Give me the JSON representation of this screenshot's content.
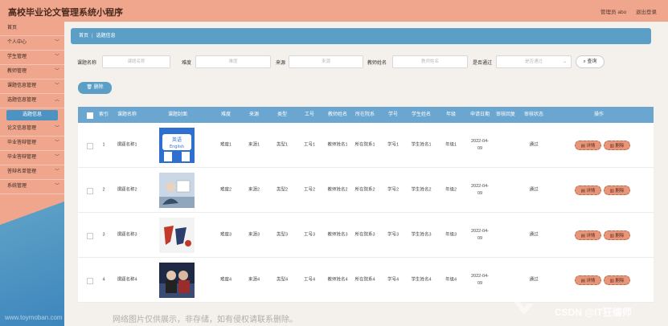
{
  "header": {
    "title": "高校毕业论文管理系统小程序",
    "admin": "管理员 abo",
    "logout": "退出登录"
  },
  "sidebar": {
    "items": [
      {
        "label": "首页",
        "chev": false
      },
      {
        "label": "个人中心",
        "chev": true
      },
      {
        "label": "学生管理",
        "chev": true
      },
      {
        "label": "教师管理",
        "chev": true
      },
      {
        "label": "课题信息管理",
        "chev": true
      },
      {
        "label": "选题信息管理",
        "chev": true
      }
    ],
    "active_sub": "选题信息",
    "items2": [
      {
        "label": "论文信息管理"
      },
      {
        "label": "毕业答辩管理"
      },
      {
        "label": "毕业答辩管理"
      },
      {
        "label": "答辩名单管理"
      },
      {
        "label": "系统管理"
      }
    ]
  },
  "breadcrumb": {
    "home": "首页",
    "sep": "|",
    "current": "选题信息"
  },
  "search": {
    "f1_label": "课题名称",
    "f1_ph": "课题名称",
    "f2_label": "难度",
    "f2_ph": "难度",
    "f3_label": "来源",
    "f3_ph": "来源",
    "f4_label": "教师姓名",
    "f4_ph": "教师姓名",
    "f5_label": "是否通过",
    "f5_ph": "是否通过",
    "button": "查询"
  },
  "delete_top": "删除",
  "table": {
    "headers": [
      "索引",
      "课题名称",
      "课题封面",
      "难度",
      "来源",
      "类型",
      "工号",
      "教师姓名",
      "所在院系",
      "学号",
      "学生姓名",
      "年级",
      "申请日期",
      "审核回复",
      "审核状态",
      "操作"
    ],
    "rows": [
      {
        "idx": "1",
        "name": "课题名称1",
        "diff": "难度1",
        "src": "来源1",
        "type": "类型1",
        "no": "工号1",
        "teacher": "教师姓名1",
        "dept": "所在院系1",
        "sid": "学号1",
        "sname": "学生姓名1",
        "grade": "年级1",
        "date": "2022-04-09",
        "reply": "",
        "status": "通过"
      },
      {
        "idx": "2",
        "name": "课题名称2",
        "diff": "难度2",
        "src": "来源2",
        "type": "类型2",
        "no": "工号2",
        "teacher": "教师姓名2",
        "dept": "所在院系2",
        "sid": "学号2",
        "sname": "学生姓名2",
        "grade": "年级2",
        "date": "2022-04-09",
        "reply": "",
        "status": "通过"
      },
      {
        "idx": "3",
        "name": "课题名称3",
        "diff": "难度3",
        "src": "来源3",
        "type": "类型3",
        "no": "工号3",
        "teacher": "教师姓名3",
        "dept": "所在院系3",
        "sid": "学号3",
        "sname": "学生姓名3",
        "grade": "年级3",
        "date": "2022-04-09",
        "reply": "",
        "status": "通过"
      },
      {
        "idx": "4",
        "name": "课题名称4",
        "diff": "难度4",
        "src": "来源4",
        "type": "类型4",
        "no": "工号4",
        "teacher": "教师姓名4",
        "dept": "所在院系4",
        "sid": "学号4",
        "sname": "学生姓名4",
        "grade": "年级4",
        "date": "2022-04-09",
        "reply": "",
        "status": "通过"
      }
    ],
    "detail_btn": "详情",
    "delete_btn": "删除"
  },
  "watermarks": {
    "left": "www.toymoban.com",
    "middle": "网络图片仅供展示，非存储，如有侵权请联系删除。",
    "right": "CSDN @IT狂编师"
  },
  "colors": {
    "accent": "#efa68c",
    "blue": "#5b9fc6"
  }
}
